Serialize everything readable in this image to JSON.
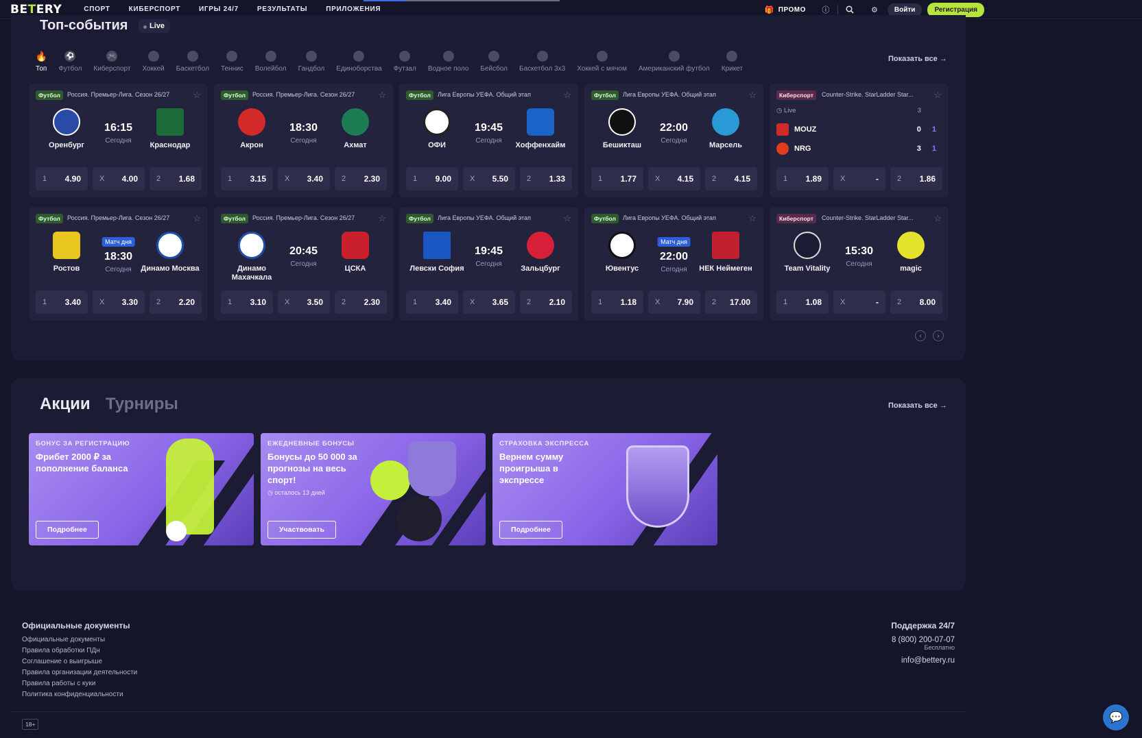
{
  "header": {
    "logo_a": "BE",
    "logo_x": "T",
    "logo_b": "ERY",
    "nav": [
      "СПОРТ",
      "КИБЕРСПОРТ",
      "ИГРЫ 24/7",
      "РЕЗУЛЬТАТЫ",
      "ПРИЛОЖЕНИЯ"
    ],
    "promo": "ПРОМО",
    "login": "Войти",
    "register": "Регистрация"
  },
  "top": {
    "title": "Топ-события",
    "live": "Live",
    "show_all": "Показать все →",
    "sports": [
      "Топ",
      "Футбол",
      "Киберспорт",
      "Хоккей",
      "Баскетбол",
      "Теннис",
      "Волейбол",
      "Гандбол",
      "Единоборства",
      "Футзал",
      "Водное поло",
      "Бейсбол",
      "Баскетбол 3x3",
      "Хоккей с мячом",
      "Американский футбол",
      "Крикет"
    ],
    "cards": [
      {
        "tag": "Футбол",
        "league": "Россия. Премьер-Лига. Сезон 26/27",
        "home": "Оренбург",
        "away": "Краснодар",
        "time": "16:15",
        "day": "Сегодня",
        "o1": "4.90",
        "ox": "4.00",
        "o2": "1.68"
      },
      {
        "tag": "Футбол",
        "league": "Россия. Премьер-Лига. Сезон 26/27",
        "home": "Акрон",
        "away": "Ахмат",
        "time": "18:30",
        "day": "Сегодня",
        "o1": "3.15",
        "ox": "3.40",
        "o2": "2.30"
      },
      {
        "tag": "Футбол",
        "league": "Лига Европы УЕФА. Общий этап",
        "home": "ОФИ",
        "away": "Хоффенхайм",
        "time": "19:45",
        "day": "Сегодня",
        "o1": "9.00",
        "ox": "5.50",
        "o2": "1.33"
      },
      {
        "tag": "Футбол",
        "league": "Лига Европы УЕФА. Общий этап",
        "home": "Бешикташ",
        "away": "Марсель",
        "time": "22:00",
        "day": "Сегодня",
        "o1": "1.77",
        "ox": "4.15",
        "o2": "4.15"
      },
      {
        "tag": "Киберспорт",
        "league": "Counter-Strike. StarLadder Star...",
        "live": "Live",
        "map": "3",
        "t1": "MOUZ",
        "t1a": "0",
        "t1b": "1",
        "t2": "NRG",
        "t2a": "3",
        "t2b": "1",
        "o1": "1.89",
        "ox": "-",
        "o2": "1.86"
      },
      {
        "tag": "Футбол",
        "league": "Россия. Премьер-Лига. Сезон 26/27",
        "home": "Ростов",
        "away": "Динамо Москва",
        "time": "18:30",
        "day": "Сегодня",
        "motd": "Матч дня",
        "o1": "3.40",
        "ox": "3.30",
        "o2": "2.20"
      },
      {
        "tag": "Футбол",
        "league": "Россия. Премьер-Лига. Сезон 26/27",
        "home": "Динамо Махачкала",
        "away": "ЦСКА",
        "time": "20:45",
        "day": "Сегодня",
        "o1": "3.10",
        "ox": "3.50",
        "o2": "2.30"
      },
      {
        "tag": "Футбол",
        "league": "Лига Европы УЕФА. Общий этап",
        "home": "Левски София",
        "away": "Зальцбург",
        "time": "19:45",
        "day": "Сегодня",
        "o1": "3.40",
        "ox": "3.65",
        "o2": "2.10"
      },
      {
        "tag": "Футбол",
        "league": "Лига Европы УЕФА. Общий этап",
        "home": "Ювентус",
        "away": "НЕК Неймеген",
        "time": "22:00",
        "day": "Сегодня",
        "motd": "Матч дня",
        "o1": "1.18",
        "ox": "7.90",
        "o2": "17.00"
      },
      {
        "tag": "Киберспорт",
        "league": "Counter-Strike. StarLadder Star...",
        "home": "Team Vitality",
        "away": "magic",
        "time": "15:30",
        "day": "Сегодня",
        "o1": "1.08",
        "ox": "-",
        "o2": "8.00"
      }
    ],
    "labels": {
      "one": "1",
      "x": "X",
      "two": "2"
    }
  },
  "promos": {
    "tab_active": "Акции",
    "tab_inactive": "Турниры",
    "show_all": "Показать все →",
    "items": [
      {
        "title": "БОНУС ЗА РЕГИСТРАЦИЮ",
        "text": "Фрибет 2000 ₽ за пополнение баланса",
        "button": "Подробнее"
      },
      {
        "title": "ЕЖЕДНЕВНЫЕ БОНУСЫ",
        "text": "Бонусы до 50 000 за прогнозы на весь спорт!",
        "note": "осталось 13 дней",
        "button": "Участвовать"
      },
      {
        "title": "СТРАХОВКА ЭКСПРЕССА",
        "text": "Вернем сумму проигрыша в экспрессе",
        "button": "Подробнее"
      }
    ]
  },
  "footer": {
    "docs_title": "Официальные документы",
    "links": [
      "Официальные документы",
      "Правила обработки ПДн",
      "Соглашение о выигрыше",
      "Правила организации деятельности",
      "Правила работы с куки",
      "Политика конфиденциальности"
    ],
    "support_title": "Поддержка 24/7",
    "phone": "8 (800) 200-07-07",
    "free": "Бесплатно",
    "email": "info@bettery.ru",
    "age": "18+"
  },
  "colors": {
    "accent": "#b7e43a",
    "bg": "#15152a",
    "panel": "#1b1b33",
    "card": "#23233e"
  }
}
